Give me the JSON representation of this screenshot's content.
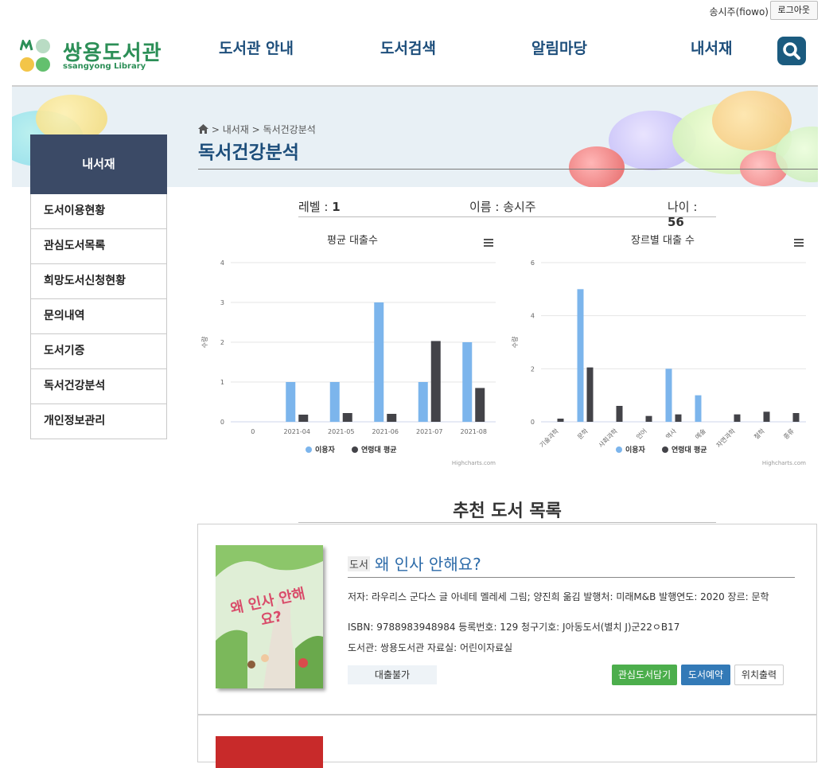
{
  "topbar": {
    "user_name": "송시주(fiowo)",
    "logout_label": "로그아웃"
  },
  "logo": {
    "title": "쌍용도서관",
    "subtitle": "ssangyong Library",
    "colors": [
      "#2c8f57",
      "#8fd0a8",
      "#f3c548",
      "#63c06e"
    ]
  },
  "nav": {
    "items": [
      "도서관 안내",
      "도서검색",
      "알림마당",
      "내서재"
    ],
    "search_icon": "search-icon"
  },
  "sidebar": {
    "title": "내서재",
    "items": [
      "도서이용현황",
      "관심도서목록",
      "희망도서신청현황",
      "문의내역",
      "도서기증",
      "독서건강분석",
      "개인정보관리"
    ]
  },
  "breadcrumb": {
    "home_icon": "home-icon",
    "items": [
      "내서재",
      "독서건강분석"
    ]
  },
  "page_title": "독서건강분석",
  "profile": {
    "level_label": "레벨 : ",
    "level_value": "1",
    "name_label": "이름 : ",
    "name_value": "송시주",
    "age_label": "나이 : ",
    "age_value": "56"
  },
  "chart_data": [
    {
      "type": "bar",
      "title": "평균 대출수",
      "ylabel": "수량",
      "categories": [
        "0",
        "2021-04",
        "2021-05",
        "2021-06",
        "2021-07",
        "2021-08"
      ],
      "ylim": [
        0,
        4
      ],
      "yticks": [
        0,
        1,
        2,
        3,
        4
      ],
      "series": [
        {
          "name": "이용자",
          "color": "#7cb5ec",
          "values": [
            0,
            1,
            1,
            3,
            1,
            2
          ]
        },
        {
          "name": "연령대 평균",
          "color": "#434348",
          "values": [
            0,
            0.18,
            0.22,
            0.2,
            2.03,
            0.85
          ]
        }
      ],
      "legend": "bottom",
      "credit": "Highcharts.com",
      "grid": true
    },
    {
      "type": "bar",
      "title": "장르별 대출 수",
      "ylabel": "수량",
      "categories": [
        "기술과학",
        "문학",
        "사회과학",
        "언어",
        "역사",
        "예술",
        "자연과학",
        "철학",
        "종류"
      ],
      "ylim": [
        0,
        6
      ],
      "yticks": [
        0,
        2,
        4,
        6
      ],
      "series": [
        {
          "name": "이용자",
          "color": "#7cb5ec",
          "values": [
            0,
            5,
            0,
            0,
            2,
            1,
            0,
            0,
            0
          ]
        },
        {
          "name": "연령대 평균",
          "color": "#434348",
          "values": [
            0.12,
            2.05,
            0.6,
            0.22,
            0.28,
            0,
            0.28,
            0.38,
            0.33
          ]
        }
      ],
      "legend": "bottom",
      "credit": "Highcharts.com",
      "grid": true
    }
  ],
  "recommend": {
    "title": "추천 도서 목록",
    "book": {
      "type_label": "도서",
      "title": "왜 인사 안해요?",
      "meta1": "저자: 라우리스 군다스 글 아네테 멜레세 그림; 양진희 옮김   발행처: 미래M&B   발행연도: 2020   장르: 문학",
      "meta2": "ISBN: 9788983948984   등록번호: 129   청구기호: J아동도서(별치 J)군22ㅇB17",
      "meta3": "도서관: 쌍용도서관   자료실: 어린이자료실",
      "status": "대출불가",
      "btn_interest": "관심도서담기",
      "btn_reserve": "도서예약",
      "btn_print": "위치출력",
      "cover_text": "왜 인사 안해요?"
    }
  }
}
